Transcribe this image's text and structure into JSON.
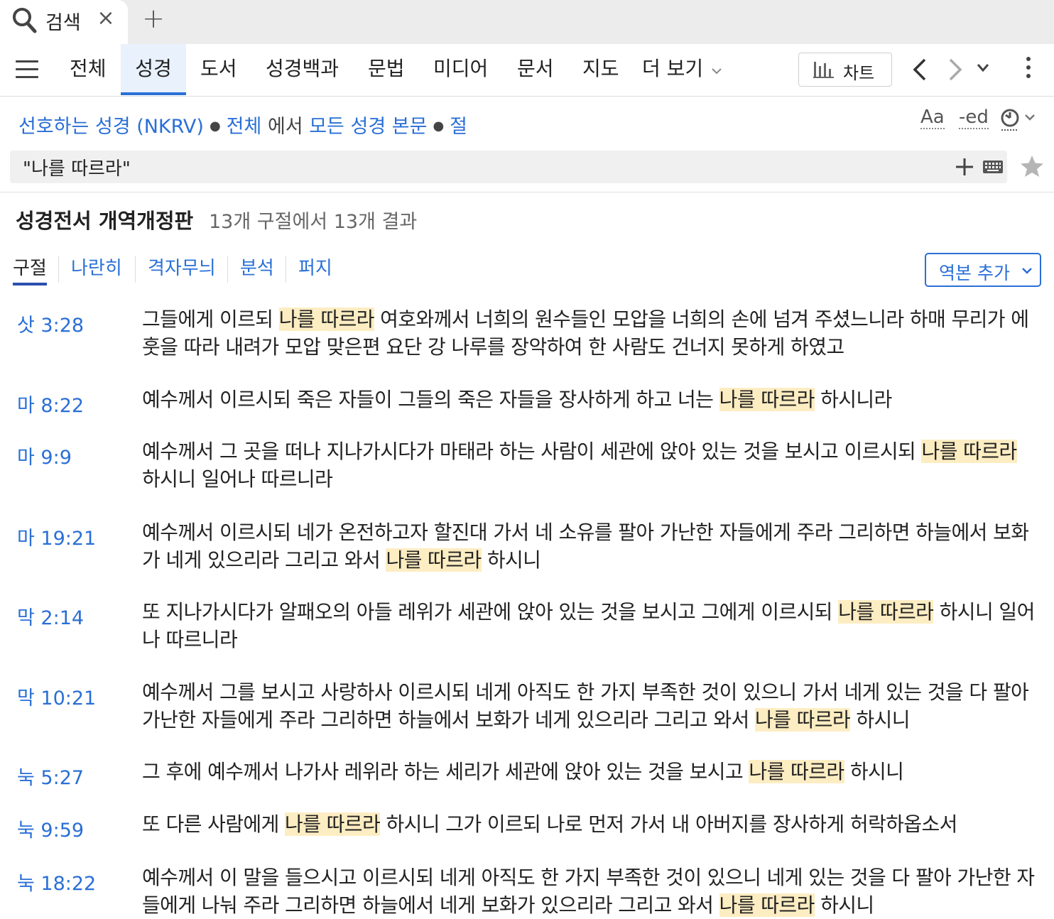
{
  "tabstrip": {
    "active_tab_title": "검색",
    "close_symbol": "×",
    "new_tab_symbol": "+"
  },
  "nav": {
    "items": [
      "전체",
      "성경",
      "도서",
      "성경백과",
      "문법",
      "미디어",
      "문서",
      "지도",
      "더 보기"
    ],
    "active_item": "성경",
    "chart_button": "차트"
  },
  "scope": {
    "bible": "선호하는 성경 (NKRV)",
    "range": "전체",
    "in_word": "에서",
    "target": "모든 성경 본문",
    "unit": "절",
    "aa_label": "Aa",
    "ed_label": "-ed"
  },
  "search": {
    "query": "\"나를 따르라\""
  },
  "results_header": {
    "title": "성경전서 개역개정판",
    "count": "13개 구절에서 13개 결과"
  },
  "view_tabs": [
    "구절",
    "나란히",
    "격자무늬",
    "분석",
    "퍼지"
  ],
  "active_view_tab": "구절",
  "add_version_button": "역본 추가",
  "results": [
    {
      "ref": "삿 3:28",
      "before": "그들에게 이르되 ",
      "match": "나를 따르라",
      "after": " 여호와께서 너희의 원수들인 모압을 너희의 손에 넘겨 주셨느니라 하매 무리가 에훗을 따라 내려가 모압 맞은편 요단 강 나루를 장악하여 한 사람도 건너지 못하게 하였고"
    },
    {
      "ref": "마 8:22",
      "before": "예수께서 이르시되 죽은 자들이 그들의 죽은 자들을 장사하게 하고 너는 ",
      "match": "나를 따르라",
      "after": " 하시니라"
    },
    {
      "ref": "마 9:9",
      "before": "예수께서 그 곳을 떠나 지나가시다가 마태라 하는 사람이 세관에 앉아 있는 것을 보시고 이르시되 ",
      "match": "나를 따르라",
      "after": " 하시니 일어나 따르니라"
    },
    {
      "ref": "마 19:21",
      "before": "예수께서 이르시되 네가 온전하고자 할진대 가서 네 소유를 팔아 가난한 자들에게 주라 그리하면 하늘에서 보화가 네게 있으리라 그리고 와서 ",
      "match": "나를 따르라",
      "after": " 하시니"
    },
    {
      "ref": "막 2:14",
      "before": "또 지나가시다가 알패오의 아들 레위가 세관에 앉아 있는 것을 보시고 그에게 이르시되 ",
      "match": "나를 따르라",
      "after": " 하시니 일어나 따르니라"
    },
    {
      "ref": "막 10:21",
      "before": "예수께서 그를 보시고 사랑하사 이르시되 네게 아직도 한 가지 부족한 것이 있으니 가서 네게 있는 것을 다 팔아 가난한 자들에게 주라 그리하면 하늘에서 보화가 네게 있으리라 그리고 와서 ",
      "match": "나를 따르라",
      "after": " 하시니"
    },
    {
      "ref": "눅 5:27",
      "before": "그 후에 예수께서 나가사 레위라 하는 세리가 세관에 앉아 있는 것을 보시고 ",
      "match": "나를 따르라",
      "after": " 하시니"
    },
    {
      "ref": "눅 9:59",
      "before": "또 다른 사람에게 ",
      "match": "나를 따르라",
      "after": " 하시니 그가 이르되 나로 먼저 가서 내 아버지를 장사하게 허락하옵소서"
    },
    {
      "ref": "눅 18:22",
      "before": "예수께서 이 말을 들으시고 이르시되 네게 아직도 한 가지 부족한 것이 있으니 네게 있는 것을 다 팔아 가난한 자들에게 나눠 주라 그리하면 하늘에서 네게 보화가 있으리라 그리고 와서 ",
      "match": "나를 따르라",
      "after": " 하시니"
    }
  ],
  "colors": {
    "link": "#2a6fd6",
    "highlight": "#fdedc2",
    "active_tab_bg": "#e8f1fc"
  }
}
